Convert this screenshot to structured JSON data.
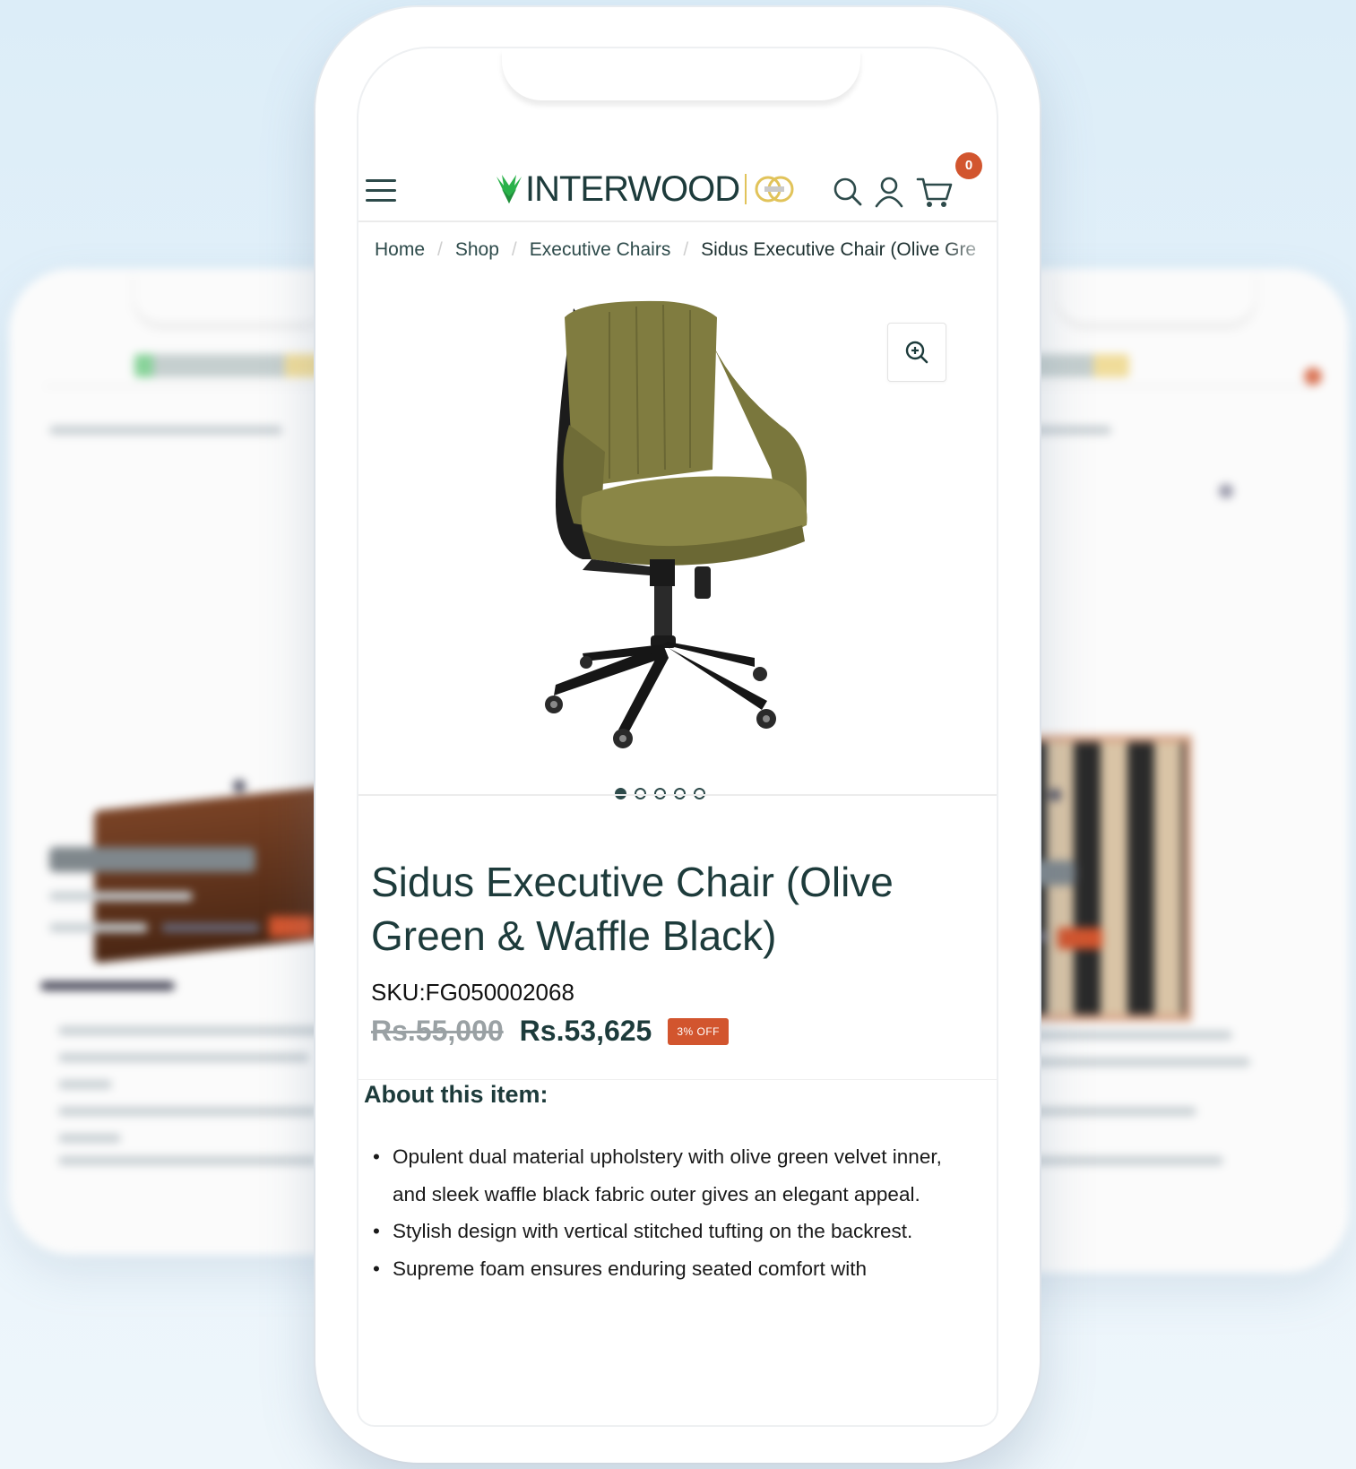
{
  "header": {
    "logo_text": "INTERWOOD",
    "cart_count": "0"
  },
  "breadcrumb": {
    "items": [
      "Home",
      "Shop",
      "Executive Chairs"
    ],
    "current": "Sidus Executive Chair (Olive Gre"
  },
  "gallery": {
    "image_count": 5,
    "active_index": 0
  },
  "product": {
    "title": "Sidus Executive Chair (Olive Green & Waffle Black)",
    "sku": "SKU:FG050002068",
    "old_price": "Rs.55,000",
    "price": "Rs.53,625",
    "discount": "3% OFF",
    "about_heading": "About this item:",
    "features": [
      "Opulent dual material upholstery with olive green velvet inner, and sleek waffle black fabric outer gives an elegant appeal.",
      "Stylish design with vertical stitched tufting on the backrest.",
      "Supreme foam ensures enduring seated comfort with"
    ]
  },
  "colors": {
    "brand_dark": "#1d3b3b",
    "accent": "#d2552e",
    "logo_green": "#2ab24a",
    "chair_fabric": "#7e7a3e"
  }
}
